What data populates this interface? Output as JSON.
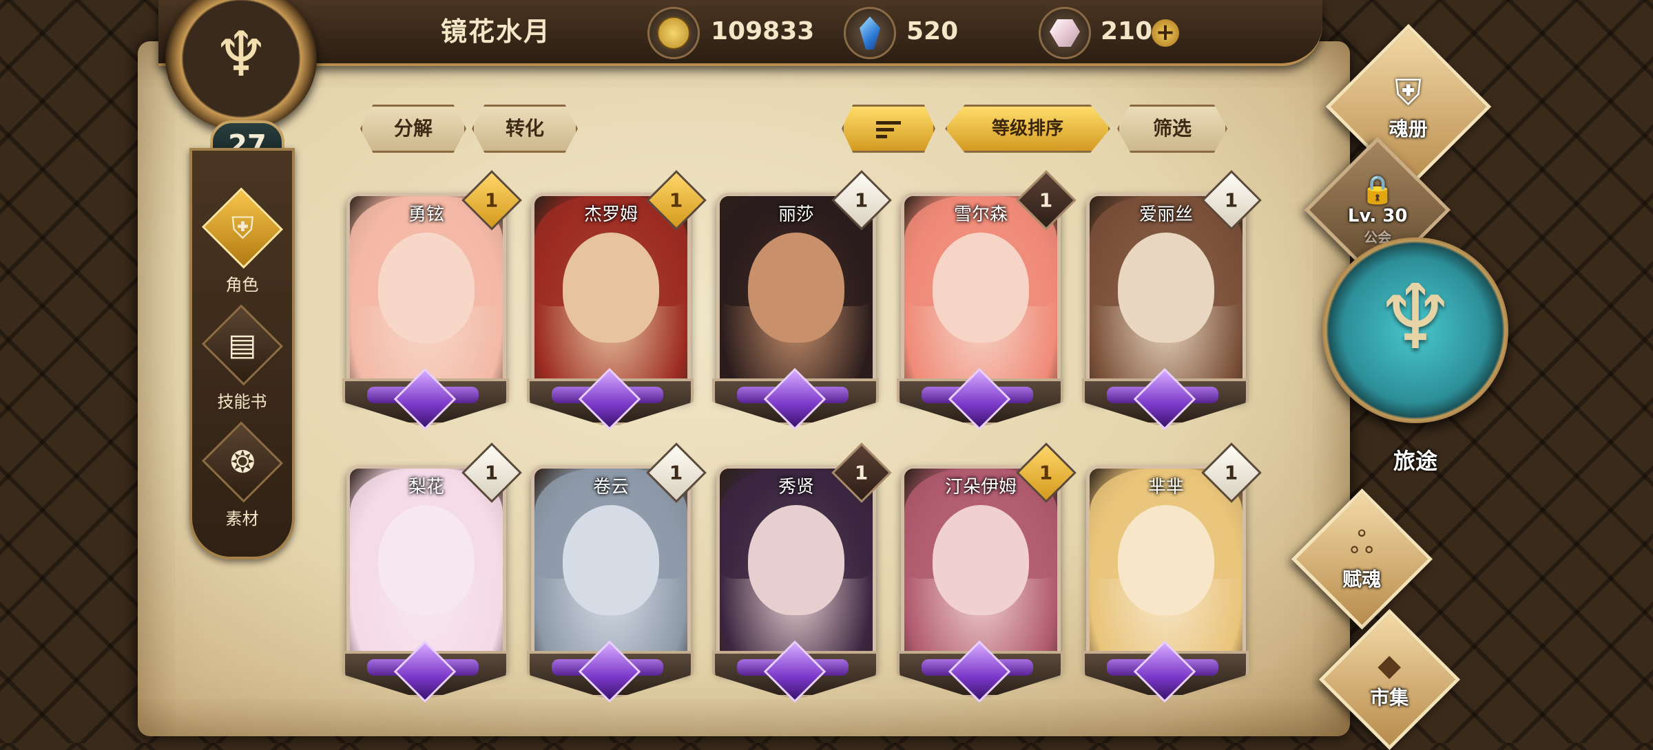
{
  "header": {
    "player_name": "镜花水月",
    "level": "27",
    "currencies": [
      {
        "name": "gold-coin",
        "value": "109833"
      },
      {
        "name": "blue-gem",
        "value": "520"
      },
      {
        "name": "crystal",
        "value": "210"
      }
    ],
    "plus_label": "+"
  },
  "left_nav": {
    "items": [
      {
        "label": "角色",
        "icon": "helmet-icon",
        "active": true
      },
      {
        "label": "技能书",
        "icon": "skill-book-icon",
        "active": false
      },
      {
        "label": "素材",
        "icon": "material-icon",
        "active": false
      }
    ]
  },
  "toolbar": {
    "decompose": "分解",
    "convert": "转化",
    "sort_icon": "sort-icon",
    "sort_by_level": "等级排序",
    "filter": "筛选"
  },
  "cards": [
    {
      "name": "勇铉",
      "count": "1",
      "badge": "gold"
    },
    {
      "name": "杰罗姆",
      "count": "1",
      "badge": "gold"
    },
    {
      "name": "丽莎",
      "count": "1",
      "badge": "white"
    },
    {
      "name": "雪尔森",
      "count": "1",
      "badge": "dark"
    },
    {
      "name": "爱丽丝",
      "count": "1",
      "badge": "white"
    },
    {
      "name": "梨花",
      "count": "1",
      "badge": "white"
    },
    {
      "name": "卷云",
      "count": "1",
      "badge": "white"
    },
    {
      "name": "秀贤",
      "count": "1",
      "badge": "dark"
    },
    {
      "name": "汀朵伊姆",
      "count": "1",
      "badge": "gold"
    },
    {
      "name": "芈芈",
      "count": "1",
      "badge": "white"
    }
  ],
  "right_nav": {
    "soul_book": "魂册",
    "locked_level": "Lv. 30",
    "locked_hint": "公会",
    "journey": "旅途",
    "endow_soul": "赋魂",
    "market": "市集"
  },
  "colors": {
    "parchment": "#e5d5ad",
    "gold_accent": "#d39b22",
    "journey_teal": "#2d8e98",
    "rarity_purple": "#7b38c9"
  }
}
